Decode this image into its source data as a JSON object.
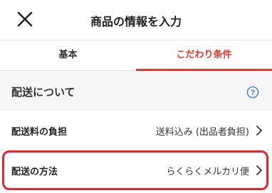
{
  "header": {
    "title": "商品の情報を入力",
    "close_icon": "close-icon"
  },
  "tabs": [
    {
      "label": "基本",
      "active": false
    },
    {
      "label": "こだわり条件",
      "active": true
    }
  ],
  "section": {
    "title": "配送について",
    "help_icon": "question-circle-icon"
  },
  "rows": [
    {
      "label": "配送料の負担",
      "value": "送料込み (出品者負担)"
    },
    {
      "label": "配送の方法",
      "value": "らくらくメルカリ便"
    }
  ],
  "colors": {
    "accent": "#ea352d",
    "highlight": "#e8252e",
    "help_icon": "#3c7bd6"
  }
}
